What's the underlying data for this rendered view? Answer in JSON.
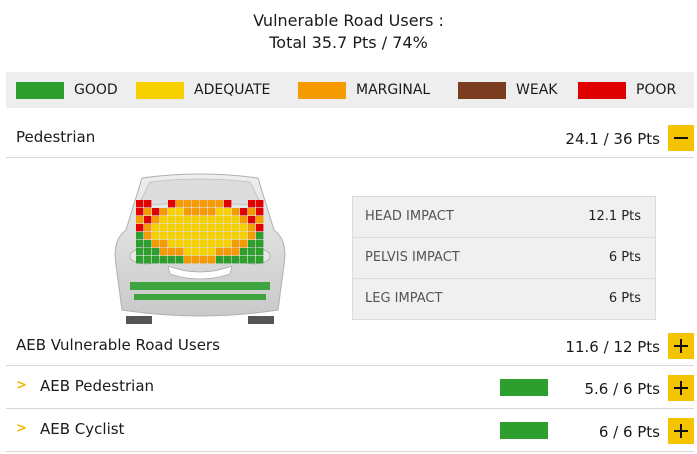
{
  "header": {
    "title_line1": "Vulnerable Road Users :",
    "title_line2": "Total 35.7 Pts / 74%"
  },
  "legend": [
    {
      "label": "GOOD",
      "color": "#2e9e2e"
    },
    {
      "label": "ADEQUATE",
      "color": "#f7d000"
    },
    {
      "label": "MARGINAL",
      "color": "#f59a00"
    },
    {
      "label": "WEAK",
      "color": "#7a3d22"
    },
    {
      "label": "POOR",
      "color": "#e00000"
    }
  ],
  "pedestrian": {
    "label": "Pedestrian",
    "score": "24.1 / 36 Pts",
    "toggle": "collapse",
    "impacts": [
      {
        "name": "HEAD IMPACT",
        "value": "12.1 Pts"
      },
      {
        "name": "PELVIS IMPACT",
        "value": "6 Pts"
      },
      {
        "name": "LEG IMPACT",
        "value": "6 Pts"
      }
    ]
  },
  "aeb": {
    "label": "AEB Vulnerable Road Users",
    "score": "11.6 / 12 Pts",
    "toggle": "expand",
    "items": [
      {
        "label": "AEB Pedestrian",
        "score": "5.6 / 6 Pts",
        "rating_color": "#2e9e2e"
      },
      {
        "label": "AEB Cyclist",
        "score": "6 / 6 Pts",
        "rating_color": "#2e9e2e"
      }
    ]
  }
}
